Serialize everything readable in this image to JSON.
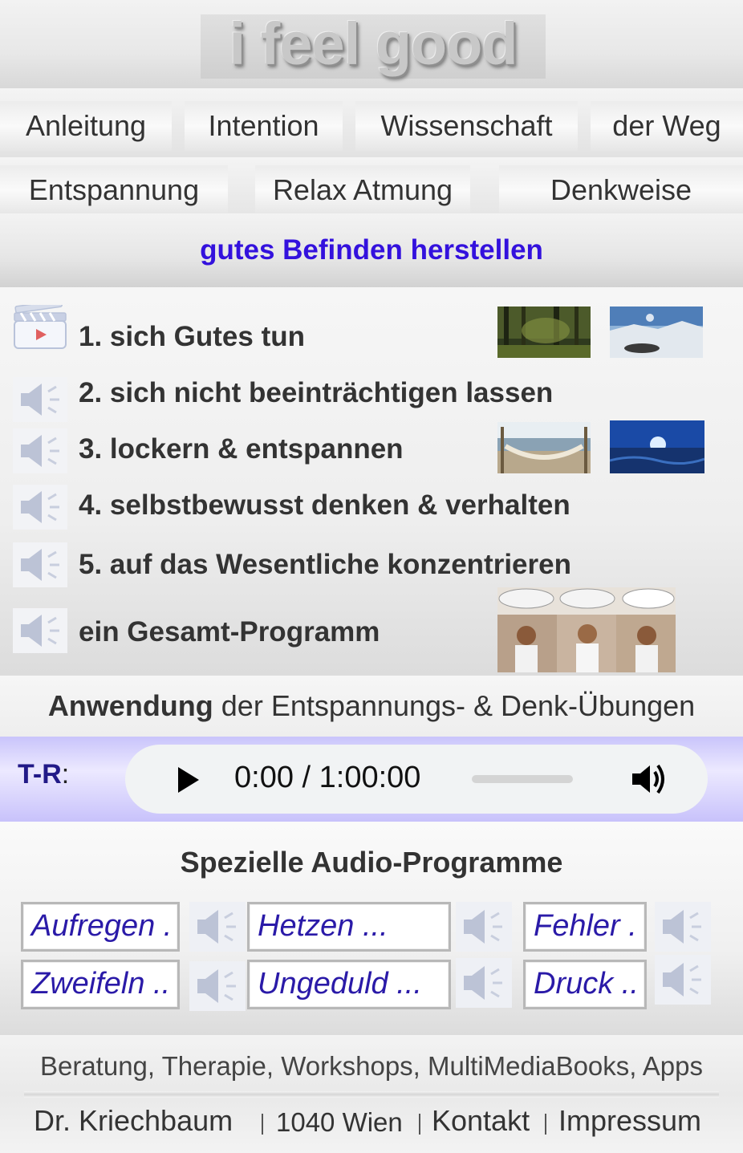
{
  "logo": {
    "text": "i feel good"
  },
  "nav": {
    "row1": [
      "Anleitung",
      "Intention",
      "Wissenschaft",
      "der Weg"
    ],
    "row2": [
      "Entspannung",
      "Relax Atmung",
      "Denkweise"
    ]
  },
  "subtitle": "gutes Befinden herstellen",
  "items": [
    {
      "label": "1. sich Gutes tun",
      "icon": "video-clapper-icon"
    },
    {
      "label": "2. sich nicht beeinträchtigen lassen",
      "icon": "speaker-icon"
    },
    {
      "label": "3. lockern & entspannen",
      "icon": "speaker-icon"
    },
    {
      "label": "4. selbstbewusst denken & verhalten",
      "icon": "speaker-icon"
    },
    {
      "label": "5. auf das Wesentliche konzentrieren",
      "icon": "speaker-icon"
    },
    {
      "label": "ein Gesamt-Programm",
      "icon": "speaker-icon"
    }
  ],
  "anwendung": {
    "bold": "Anwendung",
    "rest": " der Entspannungs- & Denk-Übungen"
  },
  "player": {
    "label_bold": "T-R",
    "label_suffix": ":",
    "time": "0:00 / 1:00:00"
  },
  "audio": {
    "title": "Spezielle Audio-Programme",
    "buttons": [
      "Aufregen .",
      "Hetzen ...",
      "Fehler .",
      "Zweifeln ..",
      "Ungeduld ...",
      "Druck .."
    ]
  },
  "footer": {
    "line1": "Beratung, Therapie, Workshops, MultiMediaBooks, Apps",
    "links": [
      "Dr. Kriechbaum",
      "1040 Wien",
      "Kontakt",
      "Impressum"
    ]
  },
  "colors": {
    "accent": "#3311dd",
    "audio_text": "#2a1aa8",
    "player_band": "#c9c4fb"
  }
}
